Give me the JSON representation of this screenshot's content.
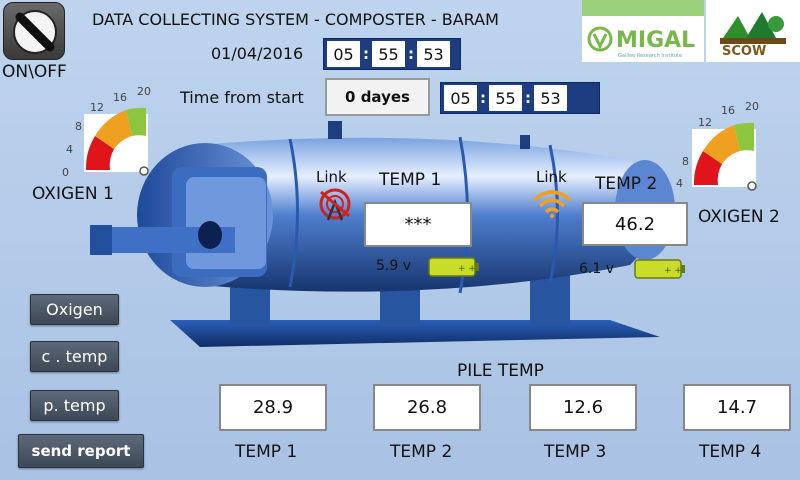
{
  "header": {
    "title": "DATA COLLECTING SYSTEM - COMPOSTER - BARAM",
    "date": "01/04/2016",
    "clock": [
      "05",
      "55",
      "53"
    ]
  },
  "power": {
    "label": "ON\\OFF"
  },
  "elapsed": {
    "label": "Time from start",
    "days": "0 dayes",
    "clock": [
      "05",
      "55",
      "53"
    ]
  },
  "logos": {
    "migal": {
      "name": "MIGAL",
      "sub": "Galilee Research Institute"
    },
    "scow": {
      "name": "SCOW"
    }
  },
  "gauge_ticks": [
    "0",
    "4",
    "8",
    "12",
    "16",
    "20"
  ],
  "oxygen": {
    "sensor1": {
      "label": "OXIGEN 1",
      "level": 0.9
    },
    "sensor2": {
      "label": "OXIGEN 2",
      "level": 0.9
    }
  },
  "composter": {
    "temp1": {
      "link_label": "Link",
      "title": "TEMP 1",
      "value": "***",
      "voltage": "5.9 v",
      "link_status": "no-signal"
    },
    "temp2": {
      "link_label": "Link",
      "title": "TEMP 2",
      "value": "46.2",
      "voltage": "6.1 v",
      "link_status": "connected"
    }
  },
  "sidebar": {
    "oxigen": "Oxigen",
    "ctemp": "c . temp",
    "ptemp": "p. temp",
    "report": "send report"
  },
  "pile": {
    "title": "PILE TEMP",
    "sensors": [
      {
        "label": "TEMP 1",
        "value": "28.9"
      },
      {
        "label": "TEMP 2",
        "value": "26.8"
      },
      {
        "label": "TEMP 3",
        "value": "12.6"
      },
      {
        "label": "TEMP 4",
        "value": "14.7"
      }
    ]
  },
  "colors": {
    "background": "#b3cbe8",
    "tank": "#3f73c8",
    "clock_frame": "#1e3d80",
    "button": "#4a5565",
    "battery": "#c9dc2a",
    "gauge_red": "#e0141b",
    "gauge_orange": "#f0a020",
    "gauge_green": "#8cc63f"
  }
}
